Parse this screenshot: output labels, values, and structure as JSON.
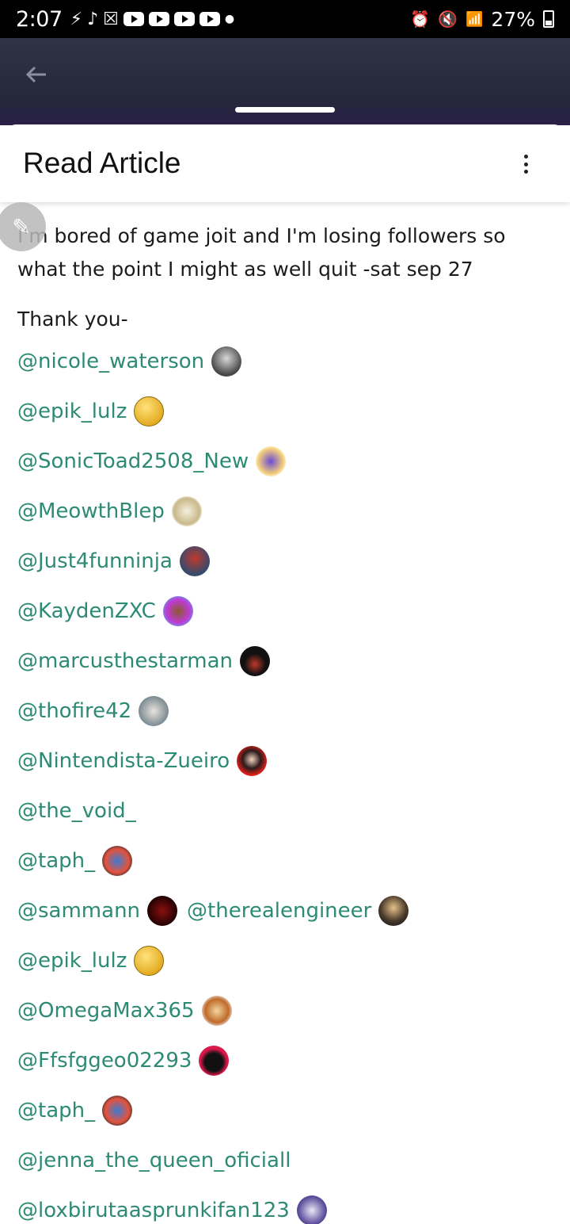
{
  "status_bar": {
    "time": "2:07",
    "battery": "27%"
  },
  "header": {
    "title": "Read Article"
  },
  "article": {
    "paragraph": "I'm bored of game joit and I'm losing followers so what the point I might as well quit -sat sep 27",
    "thanks": "Thank you-",
    "mentions": [
      [
        "@nicole_waterson"
      ],
      [
        "@epik_lulz"
      ],
      [
        "@SonicToad2508_New"
      ],
      [
        "@MeowthBlep"
      ],
      [
        "@Just4funninja"
      ],
      [
        "@KaydenZXC"
      ],
      [
        "@marcusthestarman"
      ],
      [
        "@thofire42"
      ],
      [
        "@Nintendista-Zueiro"
      ],
      [
        "@the_void_"
      ],
      [
        "@taph_"
      ],
      [
        "@sammann",
        "@therealengineer"
      ],
      [
        "@epik_lulz"
      ],
      [
        "@OmegaMax365"
      ],
      [
        "@Ffsfggeo02293"
      ],
      [
        "@taph_"
      ],
      [
        "@jenna_the_queen_oficiall"
      ],
      [
        "@loxbirutaasprunkifan123"
      ]
    ]
  },
  "colors": {
    "mention": "#2d8a73",
    "header_bg": "#2e3345"
  }
}
